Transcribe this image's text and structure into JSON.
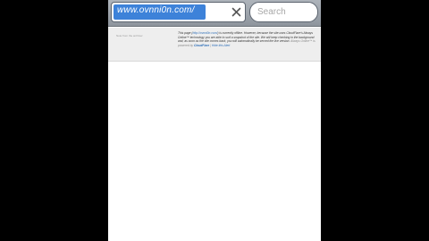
{
  "browser": {
    "url": "www.ovnni0n.com/",
    "search_placeholder": "Search"
  },
  "notice": {
    "label": "Note from the archiver",
    "parts": [
      "This page (",
      "http://ovnni0n.com/",
      ") is currently offline. However, because the site uses CloudFlare's Always Online™ technology you are able to surf a snapshot of the site. We will keep checking in the background and, as soon as the site comes back, you will automatically be served the live version. ",
      "Always Online™ is powered by",
      "CloudFlare",
      " | ",
      "Hide this Alert"
    ]
  },
  "colors": {
    "toolbar": "#9aa1a9",
    "url_selection": "#3d82d9",
    "link": "#2f6fb8",
    "notice_background": "#eeeeee"
  }
}
